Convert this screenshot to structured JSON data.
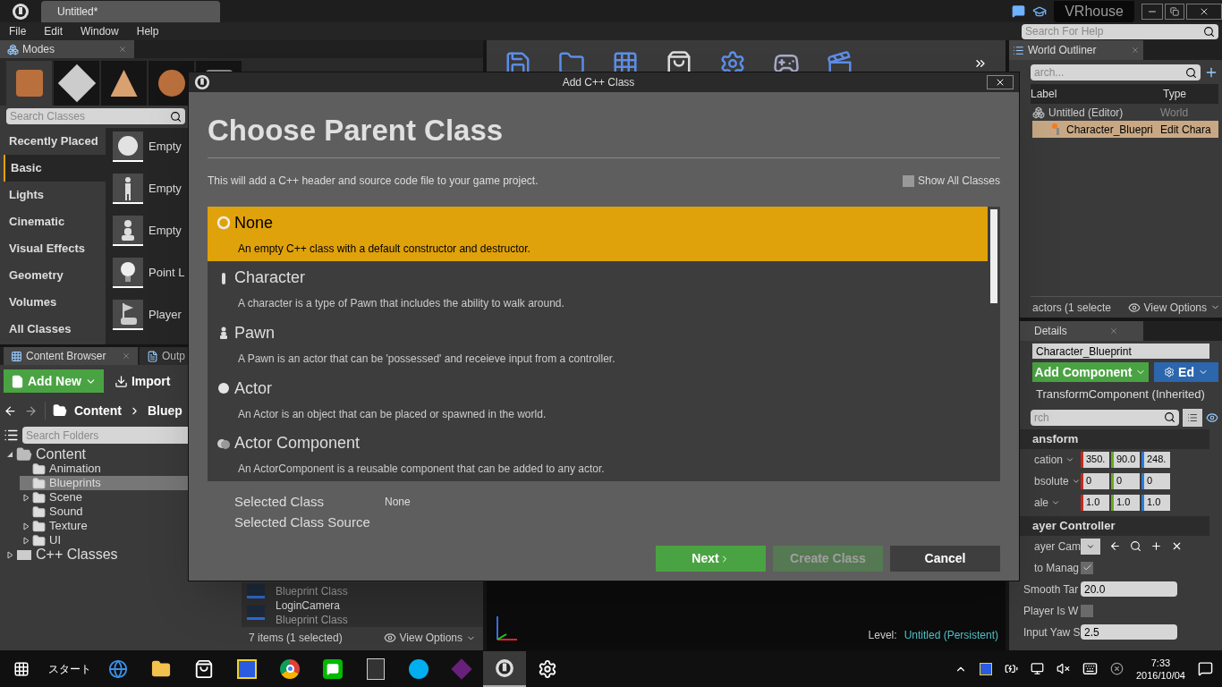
{
  "app": {
    "tab_title": "Untitled*",
    "menu": [
      "File",
      "Edit",
      "Window",
      "Help"
    ],
    "project": "VRhouse",
    "help_search": {
      "placeholder": "Search For Help"
    }
  },
  "modes": {
    "tab": "Modes",
    "search": {
      "placeholder": "Search Classes"
    },
    "categories": [
      {
        "label": "Recently Placed",
        "selected": false
      },
      {
        "label": "Basic",
        "selected": true
      },
      {
        "label": "Lights",
        "selected": false
      },
      {
        "label": "Cinematic",
        "selected": false
      },
      {
        "label": "Visual Effects",
        "selected": false
      },
      {
        "label": "Geometry",
        "selected": false
      },
      {
        "label": "Volumes",
        "selected": false
      },
      {
        "label": "All Classes",
        "selected": false
      }
    ],
    "items": [
      {
        "label": "Empty",
        "kind": "sphere"
      },
      {
        "label": "Empty",
        "kind": "figure"
      },
      {
        "label": "Empty",
        "kind": "pawn"
      },
      {
        "label": "Point L",
        "kind": "bulb"
      },
      {
        "label": "Player",
        "kind": "flag"
      }
    ]
  },
  "content_browser": {
    "tabs": [
      {
        "label": "Content Browser",
        "selected": true
      },
      {
        "label": "Outp",
        "selected": false
      }
    ],
    "add_new": "Add New",
    "import": "Import",
    "path": [
      "Content",
      "Bluep"
    ],
    "folder_search": {
      "placeholder": "Search Folders"
    },
    "tree": [
      {
        "label": "Content",
        "expanded": true,
        "kind": "root",
        "selected": false,
        "children": [
          {
            "label": "Animation",
            "kind": "folder",
            "selected": false
          },
          {
            "label": "Blueprints",
            "kind": "folder",
            "selected": true
          },
          {
            "label": "Scene",
            "expanded": false,
            "kind": "folder",
            "selected": false
          },
          {
            "label": "Sound",
            "kind": "folder",
            "selected": false
          },
          {
            "label": "Texture",
            "expanded": false,
            "kind": "folder",
            "selected": false
          },
          {
            "label": "UI",
            "expanded": false,
            "kind": "folder",
            "selected": false
          }
        ]
      },
      {
        "label": "C++ Classes",
        "expanded": false,
        "kind": "code",
        "selected": false
      }
    ],
    "assets": [
      {
        "type": "Blueprint Class"
      },
      {
        "name": "LoginCamera",
        "type": "Blueprint Class"
      }
    ],
    "status": "7 items (1 selected)",
    "view_options": "View Options"
  },
  "viewport": {
    "level_label": "Level:",
    "level_name": "Untitled (Persistent)"
  },
  "outliner": {
    "tab": "World Outliner",
    "search": {
      "placeholder": "arch..."
    },
    "columns": [
      "Label",
      "Type"
    ],
    "rows": [
      {
        "label": "Untitled (Editor)",
        "type": "World",
        "kind": "world",
        "selected": false
      },
      {
        "label": "Character_Bluepri",
        "type": "Edit Chara",
        "kind": "actor",
        "selected": true
      }
    ],
    "status": "actors (1 selecte",
    "view_options": "View Options"
  },
  "details": {
    "tab": "Details",
    "name": "Character_Blueprint",
    "add_component": "Add Component",
    "edit": "Ed",
    "component": "TransformComponent (Inherited)",
    "search": {
      "placeholder": "rch"
    },
    "sections": [
      {
        "title": "ansform",
        "rows": [
          {
            "label": "cation",
            "kind": "vector",
            "values": [
              "350.",
              "90.0",
              "248."
            ]
          },
          {
            "label": "bsolute",
            "kind": "vector",
            "values": [
              "0",
              "0",
              "0"
            ]
          },
          {
            "label": "ale",
            "kind": "vector",
            "values": [
              "1.0",
              "1.0",
              "1.0"
            ]
          }
        ]
      },
      {
        "title": "ayer Controller",
        "rows": [
          {
            "label": "ayer Cam",
            "kind": "actions"
          },
          {
            "label": "to Manag",
            "kind": "check",
            "checked": true
          },
          {
            "label": "Smooth Tar",
            "kind": "number",
            "value": "20.0"
          },
          {
            "label": "Player Is W",
            "kind": "check",
            "checked": false
          },
          {
            "label": "Input Yaw S",
            "kind": "number",
            "value": "2.5"
          }
        ]
      }
    ]
  },
  "dialog": {
    "title": "Add C++ Class",
    "heading": "Choose Parent Class",
    "description": "This will add a C++ header and source code file to your game project.",
    "show_all": {
      "label": "Show All Classes",
      "checked": false
    },
    "classes": [
      {
        "name": "None",
        "description": "An empty C++ class with a default constructor and destructor.",
        "kind": "none",
        "selected": true
      },
      {
        "name": "Character",
        "description": "A character is a type of Pawn that includes the ability to walk around.",
        "kind": "character",
        "selected": false
      },
      {
        "name": "Pawn",
        "description": "A Pawn is an actor that can be 'possessed' and receieve input from a controller.",
        "kind": "pawn",
        "selected": false
      },
      {
        "name": "Actor",
        "description": "An Actor is an object that can be placed or spawned in the world.",
        "kind": "actor",
        "selected": false
      },
      {
        "name": "Actor Component",
        "description": "An ActorComponent is a reusable component that can be added to any actor.",
        "kind": "component",
        "selected": false
      }
    ],
    "selected_class_label": "Selected Class",
    "selected_class_value": "None",
    "source_label": "Selected Class Source",
    "buttons": [
      {
        "label": "Next",
        "kind": "next",
        "disabled": false
      },
      {
        "label": "Create Class",
        "kind": "create",
        "disabled": true
      },
      {
        "label": "Cancel",
        "kind": "cancel",
        "disabled": false
      }
    ]
  },
  "taskbar": {
    "start_label": "スタート",
    "apps": [
      {
        "kind": "edge",
        "active": false
      },
      {
        "kind": "explorer",
        "active": false
      },
      {
        "kind": "store",
        "active": false
      },
      {
        "kind": "game",
        "active": false
      },
      {
        "kind": "chrome",
        "active": false
      },
      {
        "kind": "line",
        "active": false
      },
      {
        "kind": "epic",
        "active": false
      },
      {
        "kind": "skype",
        "active": false
      },
      {
        "kind": "vs",
        "active": false
      },
      {
        "kind": "unreal",
        "active": true
      },
      {
        "kind": "settings",
        "active": false
      }
    ],
    "time": "7:33",
    "date": "2016/10/04"
  }
}
